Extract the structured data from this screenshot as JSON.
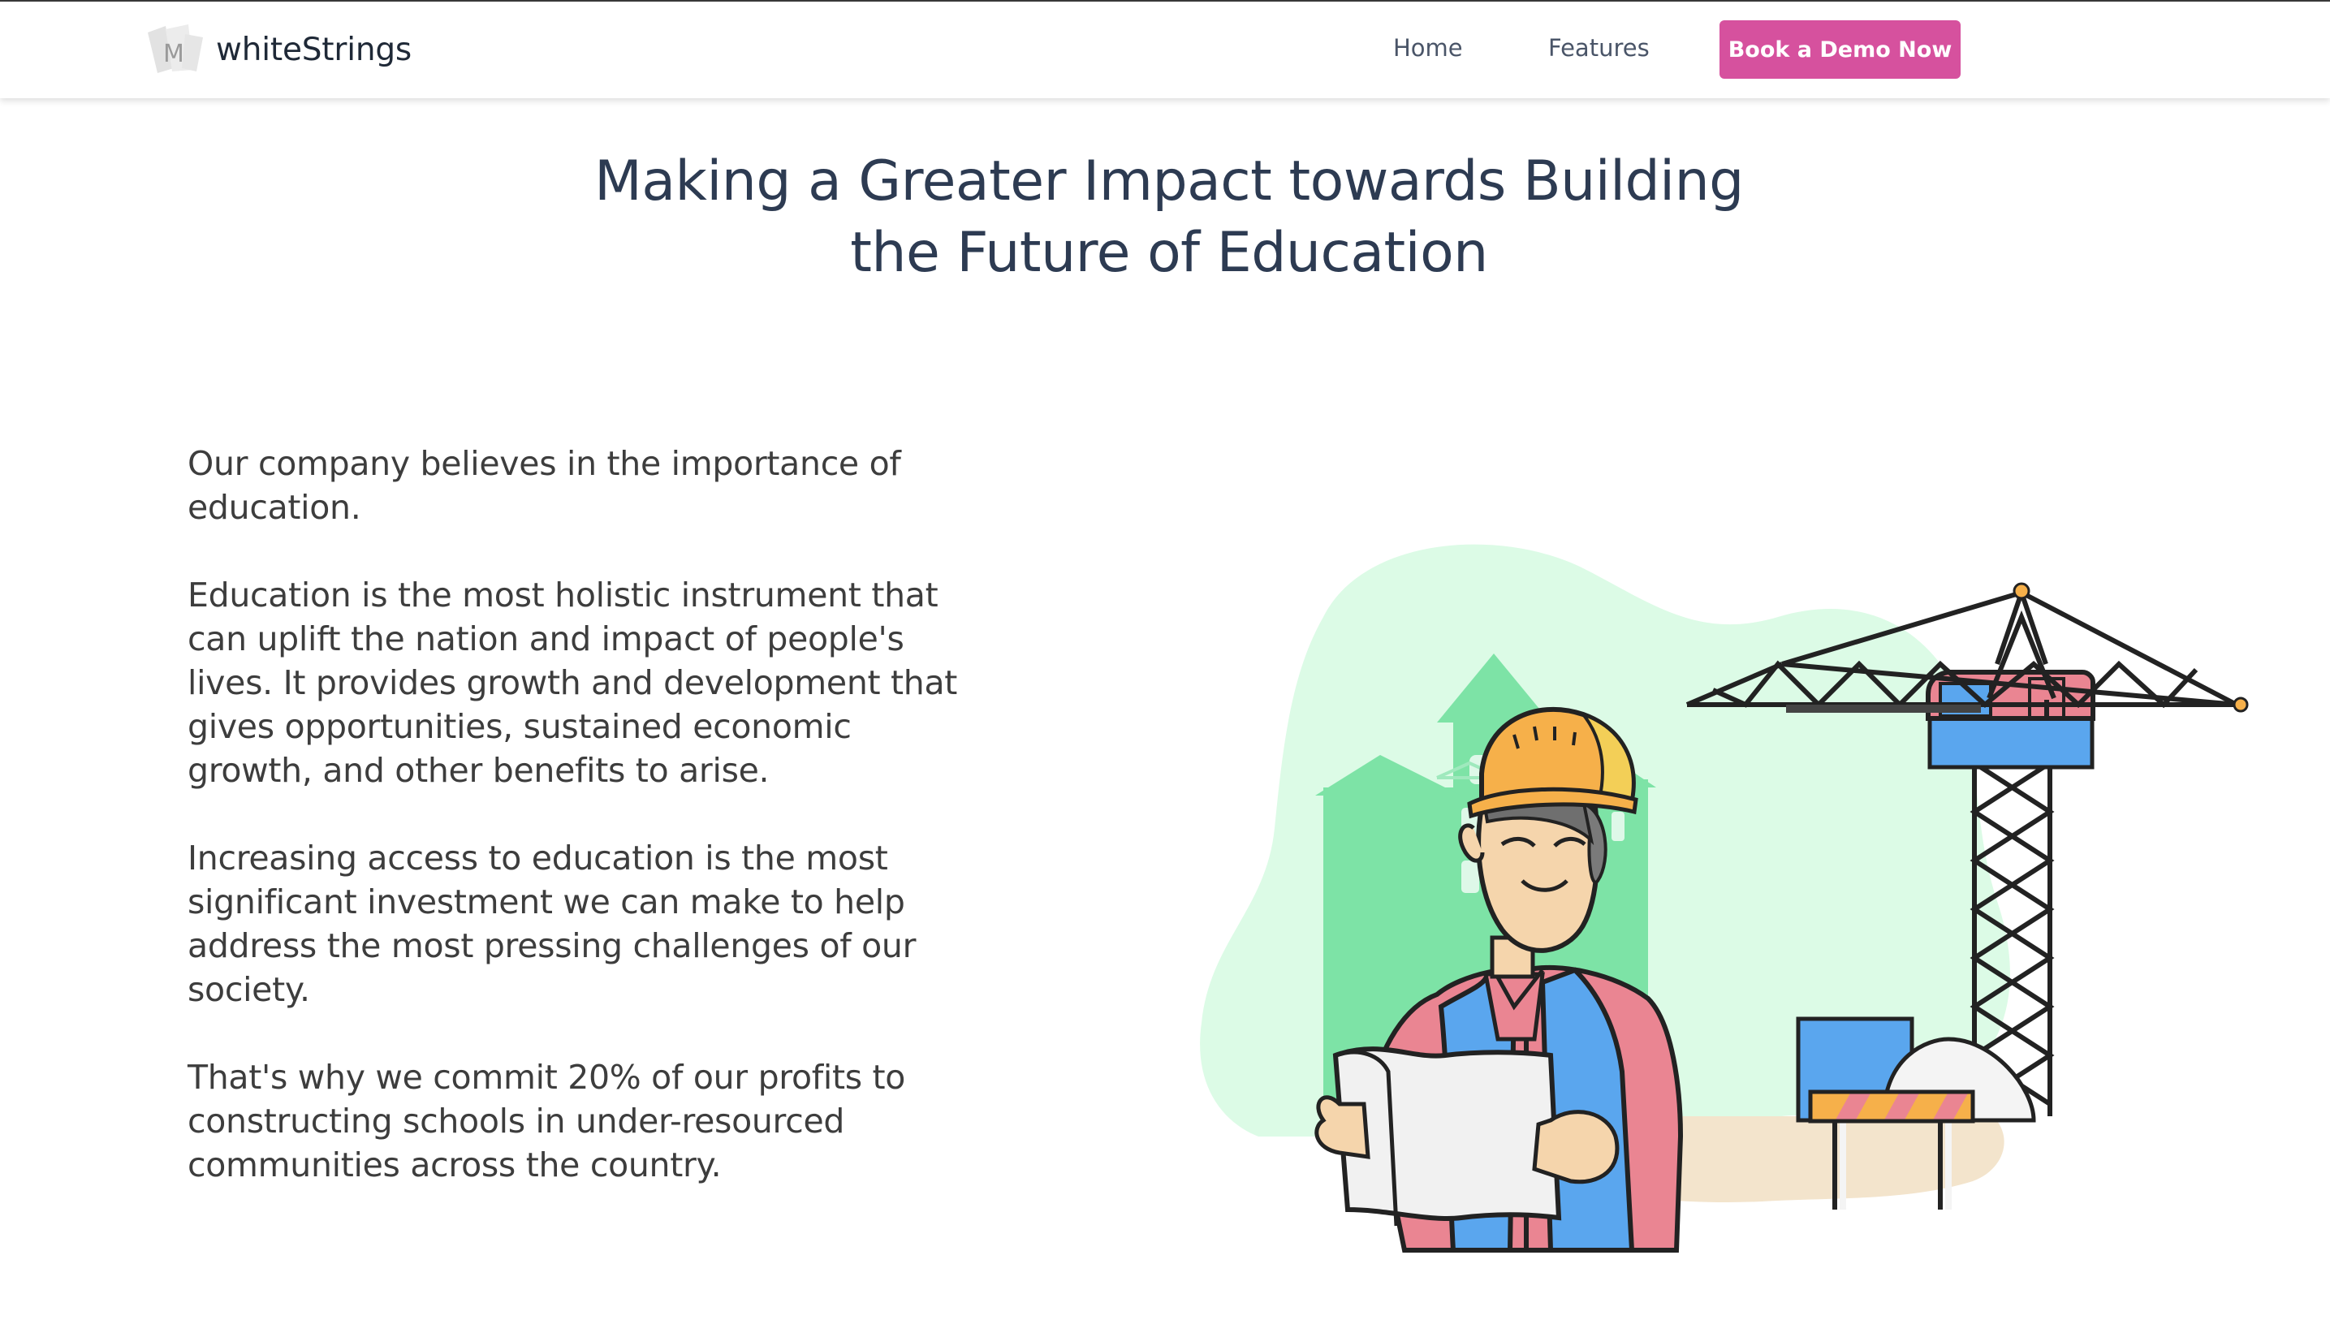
{
  "header": {
    "brand_name": "whiteStrings",
    "logo_icon": "whitestrings-logo-icon",
    "nav": {
      "home_label": "Home",
      "features_label": "Features"
    },
    "cta_label": "Book a Demo Now"
  },
  "hero": {
    "title_line_1": "Making a Greater Impact towards Building",
    "title_line_2": "the Future of Education"
  },
  "content": {
    "paragraphs": [
      "Our company believes in the importance of education.",
      "Education is the most holistic instrument that can uplift the nation and impact of people's lives. It provides growth and development that gives opportunities, sustained economic growth, and other benefits to arise.",
      "Increasing access to education is the most significant investment we can make to help address the most pressing challenges of our society.",
      "That's why we commit 20% of our profits to constructing schools in under-resourced communities across the country."
    ]
  },
  "illustration": {
    "icon": "construction-worker-illustration"
  },
  "colors": {
    "cta_background": "#d6519e",
    "title_text": "#2d3b52",
    "body_text": "#3d3d3d",
    "mint_blob": "#dcfbe6",
    "building_green": "#7de3a6",
    "helmet_orange": "#f6b04a",
    "vest_blue": "#5aa6ee",
    "shirt_pink": "#ea8592"
  }
}
